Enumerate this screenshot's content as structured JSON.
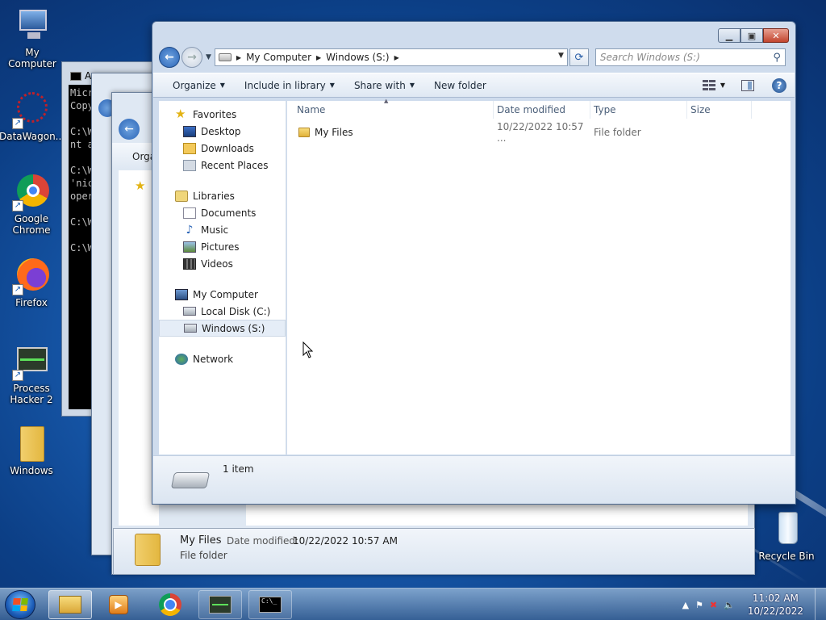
{
  "desktop": {
    "icons": [
      {
        "label": "My Computer"
      },
      {
        "label": "DataWagon..."
      },
      {
        "label": "Google Chrome"
      },
      {
        "label": "Firefox"
      },
      {
        "label": "Process Hacker 2"
      },
      {
        "label": "Windows"
      },
      {
        "label": "Recycle Bin"
      }
    ]
  },
  "cmd_window": {
    "title": "A",
    "lines": [
      "Micr",
      "Copy",
      "",
      "C:\\W",
      "nt a",
      "",
      "C:\\W",
      "'nic",
      "oper",
      "",
      "C:\\W",
      "",
      "C:\\W"
    ]
  },
  "bg_explorer": {
    "organize_label": "Orga",
    "detail": {
      "name": "My Files",
      "date_label": "Date modified:",
      "date_value": "10/22/2022 10:57 AM",
      "type": "File folder"
    }
  },
  "explorer": {
    "breadcrumb": [
      "My Computer",
      "Windows (S:)"
    ],
    "search_placeholder": "Search Windows (S:)",
    "toolbar": {
      "organize": "Organize",
      "include_in_library": "Include in library",
      "share_with": "Share with",
      "new_folder": "New folder"
    },
    "nav": {
      "favorites": "Favorites",
      "desktop": "Desktop",
      "downloads": "Downloads",
      "recent_places": "Recent Places",
      "libraries": "Libraries",
      "documents": "Documents",
      "music": "Music",
      "pictures": "Pictures",
      "videos": "Videos",
      "my_computer": "My Computer",
      "local_disk": "Local Disk (C:)",
      "windows_s": "Windows (S:)",
      "network": "Network"
    },
    "columns": {
      "name": "Name",
      "date": "Date modified",
      "type": "Type",
      "size": "Size"
    },
    "files": [
      {
        "name": "My Files",
        "date": "10/22/2022 10:57 ...",
        "type": "File folder",
        "size": ""
      }
    ],
    "status": {
      "count": "1 item"
    }
  },
  "taskbar": {
    "clock_time": "11:02 AM",
    "clock_date": "10/22/2022"
  },
  "colors": {
    "accent": "#1a5fb4",
    "window_frame": "#cfdced",
    "selection": "#e5edf7"
  }
}
